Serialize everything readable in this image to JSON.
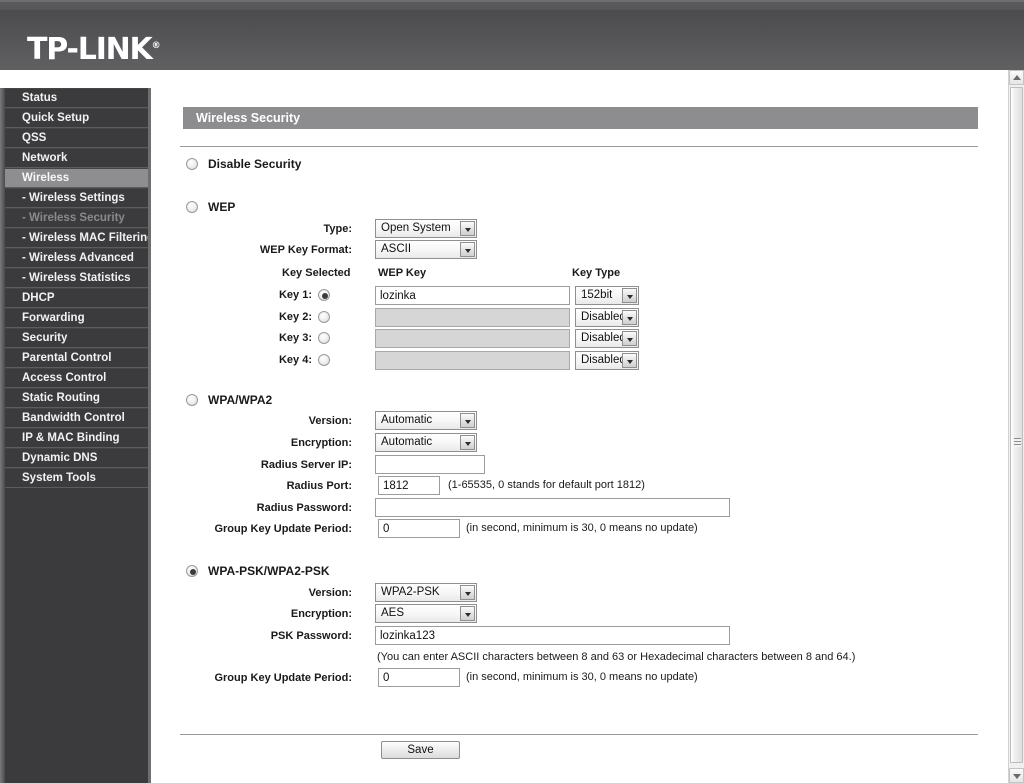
{
  "brand": {
    "name": "TP-LINK",
    "trademark": "®"
  },
  "sidebar": {
    "items": [
      {
        "label": "Status",
        "state": "normal"
      },
      {
        "label": "Quick Setup",
        "state": "normal"
      },
      {
        "label": "QSS",
        "state": "normal"
      },
      {
        "label": "Network",
        "state": "normal"
      },
      {
        "label": "Wireless",
        "state": "active"
      },
      {
        "label": "- Wireless Settings",
        "state": "sub"
      },
      {
        "label": "- Wireless Security",
        "state": "current"
      },
      {
        "label": "- Wireless MAC Filtering",
        "state": "sub"
      },
      {
        "label": "- Wireless Advanced",
        "state": "sub"
      },
      {
        "label": "- Wireless Statistics",
        "state": "sub"
      },
      {
        "label": "DHCP",
        "state": "normal"
      },
      {
        "label": "Forwarding",
        "state": "normal"
      },
      {
        "label": "Security",
        "state": "normal"
      },
      {
        "label": "Parental Control",
        "state": "normal"
      },
      {
        "label": "Access Control",
        "state": "normal"
      },
      {
        "label": "Static Routing",
        "state": "normal"
      },
      {
        "label": "Bandwidth Control",
        "state": "normal"
      },
      {
        "label": "IP & MAC Binding",
        "state": "normal"
      },
      {
        "label": "Dynamic DNS",
        "state": "normal"
      },
      {
        "label": "System Tools",
        "state": "normal"
      }
    ]
  },
  "page": {
    "title": "Wireless Security"
  },
  "disable_security": {
    "label": "Disable Security",
    "selected": false
  },
  "wep": {
    "label": "WEP",
    "selected": false,
    "type_label": "Type:",
    "type_value": "Open System",
    "key_format_label": "WEP Key Format:",
    "key_format_value": "ASCII",
    "col_key_selected": "Key Selected",
    "col_wep_key": "WEP Key",
    "col_key_type": "Key Type",
    "keys": [
      {
        "label": "Key 1:",
        "selected": true,
        "value": "lozinka",
        "type": "152bit",
        "disabled": false
      },
      {
        "label": "Key 2:",
        "selected": false,
        "value": "",
        "type": "Disabled",
        "disabled": true
      },
      {
        "label": "Key 3:",
        "selected": false,
        "value": "",
        "type": "Disabled",
        "disabled": true
      },
      {
        "label": "Key 4:",
        "selected": false,
        "value": "",
        "type": "Disabled",
        "disabled": true
      }
    ]
  },
  "wpa": {
    "label": "WPA/WPA2",
    "selected": false,
    "version_label": "Version:",
    "version_value": "Automatic",
    "encryption_label": "Encryption:",
    "encryption_value": "Automatic",
    "radius_ip_label": "Radius Server IP:",
    "radius_ip_value": "",
    "radius_port_label": "Radius Port:",
    "radius_port_value": "1812",
    "radius_port_hint": "(1-65535, 0 stands for default port 1812)",
    "radius_password_label": "Radius Password:",
    "radius_password_value": "",
    "group_key_label": "Group Key Update Period:",
    "group_key_value": "0",
    "group_key_hint": "(in second, minimum is 30, 0 means no update)"
  },
  "wpapsk": {
    "label": "WPA-PSK/WPA2-PSK",
    "selected": true,
    "version_label": "Version:",
    "version_value": "WPA2-PSK",
    "encryption_label": "Encryption:",
    "encryption_value": "AES",
    "psk_label": "PSK Password:",
    "psk_value": "lozinka123",
    "psk_hint": "(You can enter ASCII characters between 8 and 63 or Hexadecimal characters between 8 and 64.)",
    "group_key_label": "Group Key Update Period:",
    "group_key_value": "0",
    "group_key_hint": "(in second, minimum is 30, 0 means no update)"
  },
  "actions": {
    "save_label": "Save"
  },
  "colors": {
    "header_gray": "#55555 7",
    "title_bar": "#8d8d8f",
    "sidebar_bg": "#3b3b3d",
    "sidebar_active": "#8e8e90"
  }
}
